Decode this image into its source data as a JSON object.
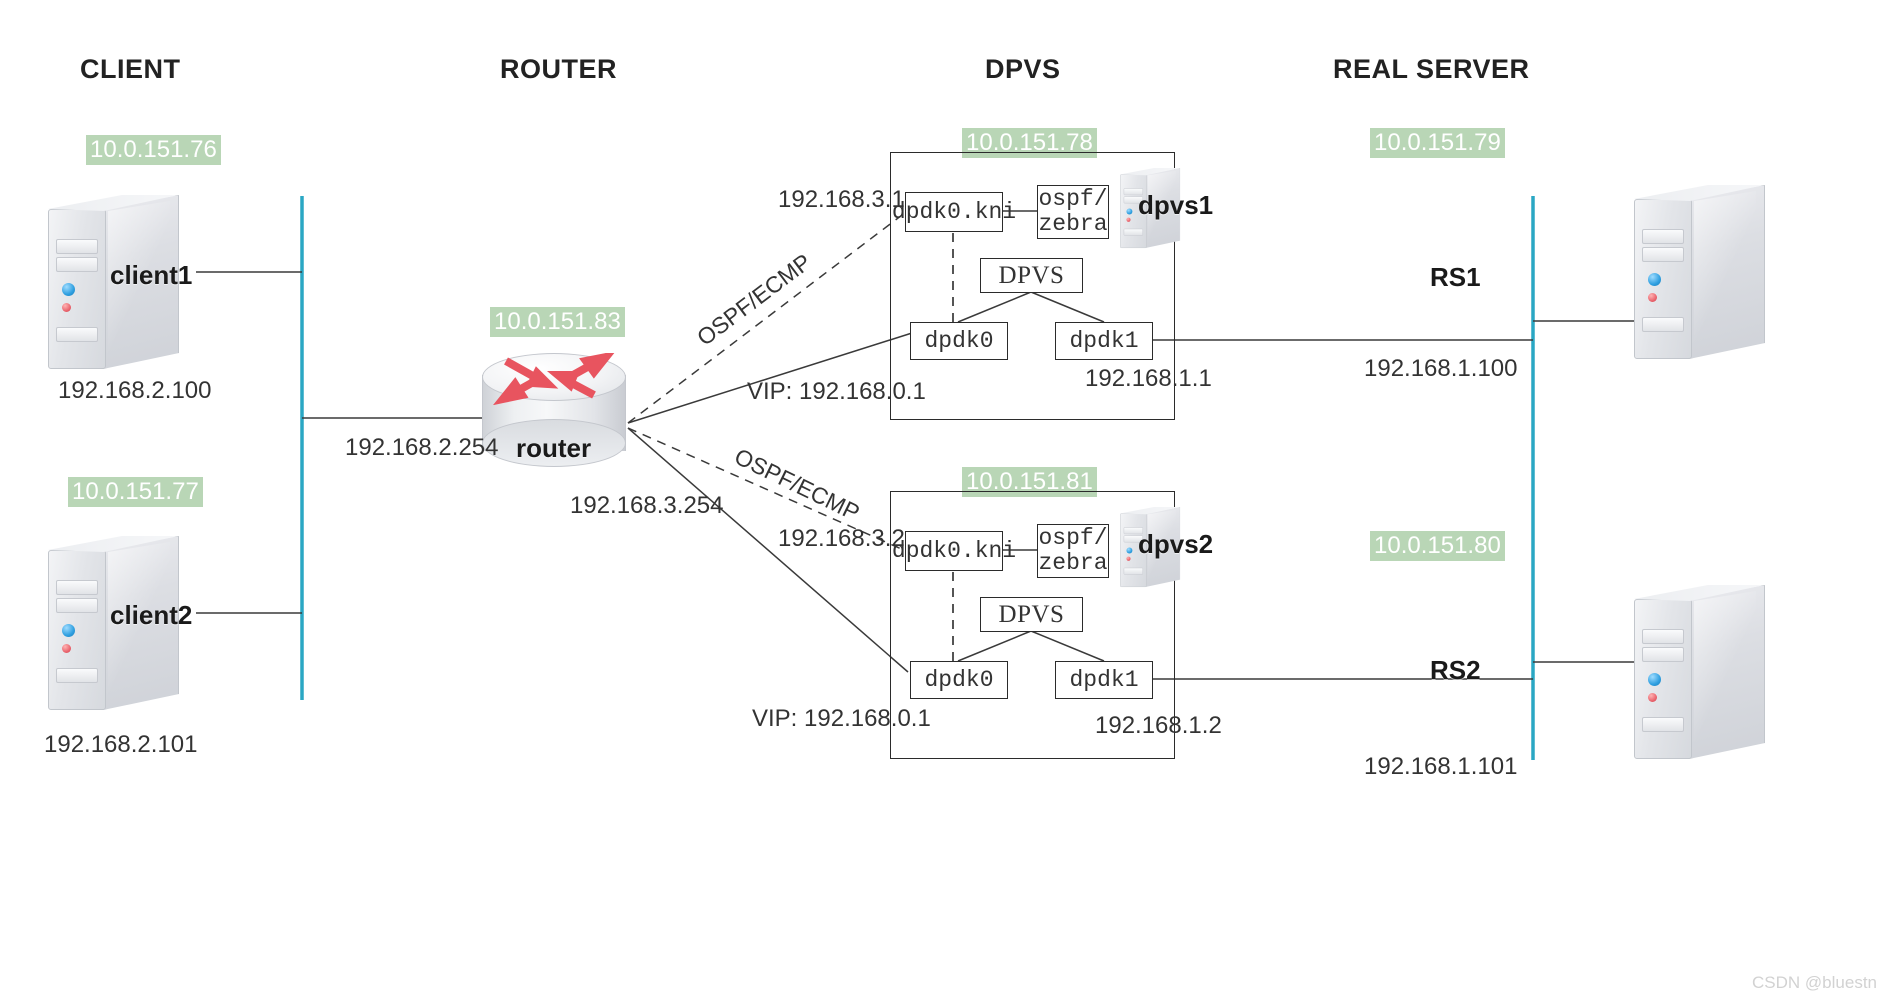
{
  "columns": [
    {
      "key": "client",
      "label": "CLIENT"
    },
    {
      "key": "router",
      "label": "ROUTER"
    },
    {
      "key": "dpvs",
      "label": "DPVS"
    },
    {
      "key": "real_server",
      "label": "REAL SERVER"
    }
  ],
  "clients": [
    {
      "name": "client1",
      "mgmt_ip": "10.0.151.76",
      "data_ip": "192.168.2.100"
    },
    {
      "name": "client2",
      "mgmt_ip": "10.0.151.77",
      "data_ip": "192.168.2.101"
    }
  ],
  "router": {
    "name": "router",
    "mgmt_ip": "10.0.151.83",
    "client_side_ip": "192.168.2.254",
    "dpvs_side_ip": "192.168.3.254"
  },
  "dpvs_nodes": [
    {
      "name": "dpvs1",
      "mgmt_ip": "10.0.151.78",
      "kni_box": "dpdk0.kni",
      "kni_ip": "192.168.3.1",
      "routing_daemon": "ospf/\nzebra",
      "routing_daemon_line1": "ospf/",
      "routing_daemon_line2": "zebra",
      "engine_box": "DPVS",
      "nic_boxes": [
        "dpdk0",
        "dpdk1"
      ],
      "vip_label": "VIP: 192.168.0.1",
      "rs_side_ip": "192.168.1.1",
      "uplink_protocol": "OSPF/ECMP"
    },
    {
      "name": "dpvs2",
      "mgmt_ip": "10.0.151.81",
      "kni_box": "dpdk0.kni",
      "kni_ip": "192.168.3.2",
      "routing_daemon": "ospf/\nzebra",
      "routing_daemon_line1": "ospf/",
      "routing_daemon_line2": "zebra",
      "engine_box": "DPVS",
      "nic_boxes": [
        "dpdk0",
        "dpdk1"
      ],
      "vip_label": "VIP: 192.168.0.1",
      "rs_side_ip": "192.168.1.2",
      "uplink_protocol": "OSPF/ECMP"
    }
  ],
  "real_servers": [
    {
      "name": "RS1",
      "mgmt_ip": "10.0.151.79",
      "data_ip": "192.168.1.100"
    },
    {
      "name": "RS2",
      "mgmt_ip": "10.0.151.80",
      "data_ip": "192.168.1.101"
    }
  ],
  "watermark": "CSDN @bluestn",
  "colors": {
    "badge_bg": "#b9d6b6",
    "badge_text": "#ffffff",
    "bus_line": "#2aa7c4",
    "wire": "#3a3a3a",
    "router_arrow": "#e8545f",
    "box_border": "#2b2b2b"
  }
}
